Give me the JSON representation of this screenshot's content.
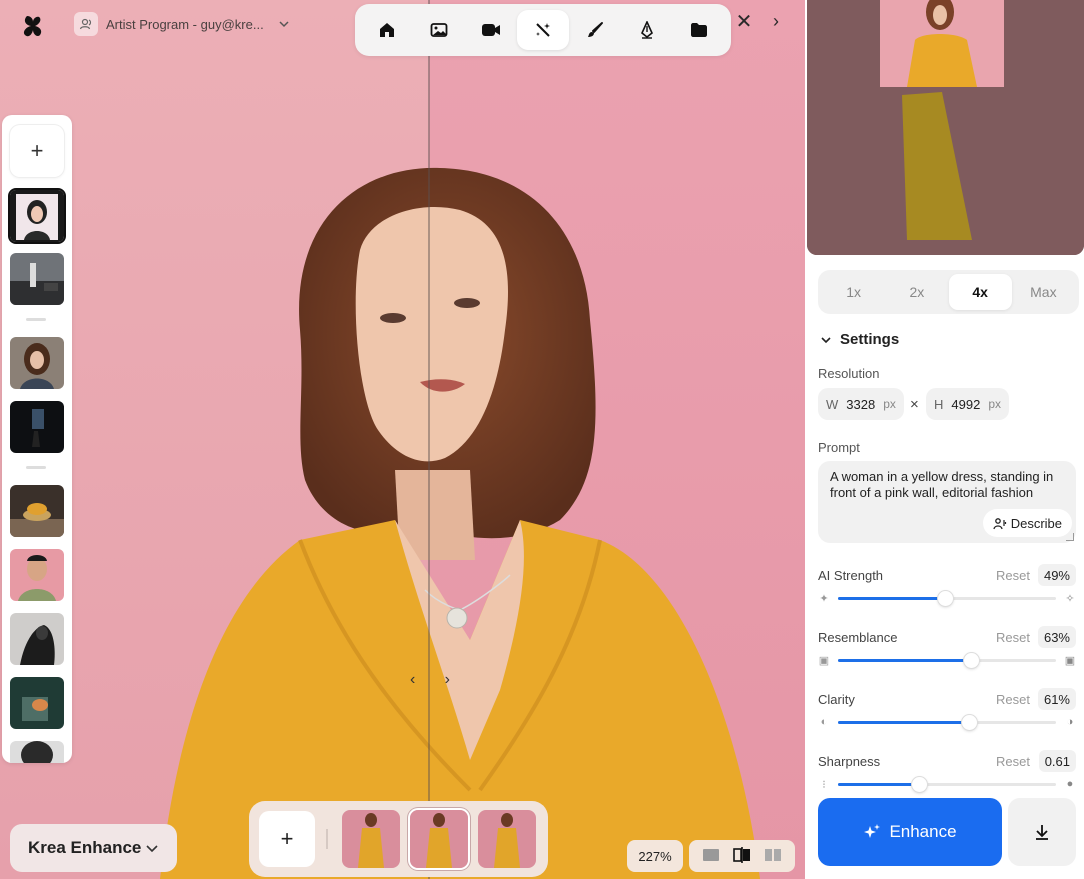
{
  "header": {
    "account_label": "Artist Program - guy@kre...",
    "icons": [
      "krea-logo-icon",
      "user-icon",
      "chevron-down-icon"
    ]
  },
  "toolbar": {
    "tools": [
      {
        "name": "home-icon"
      },
      {
        "name": "image-icon"
      },
      {
        "name": "video-icon"
      },
      {
        "name": "enhance-wand-icon",
        "active": true
      },
      {
        "name": "brush-icon"
      },
      {
        "name": "pen-nib-icon"
      },
      {
        "name": "folder-icon"
      }
    ],
    "close_glyph": "✕",
    "next_glyph": "›"
  },
  "canvas": {
    "compare_prev": "‹",
    "compare_next": "›",
    "zoom": "227%"
  },
  "history": {
    "add_glyph": "+"
  },
  "model": {
    "label": "Krea Enhance"
  },
  "strip": {
    "add_glyph": "+"
  },
  "panel": {
    "scale_options": [
      "1x",
      "2x",
      "4x",
      "Max"
    ],
    "scale_selected": "4x",
    "settings_title": "Settings",
    "resolution_label": "Resolution",
    "width": {
      "key": "W",
      "value": "3328",
      "unit": "px"
    },
    "height": {
      "key": "H",
      "value": "4992",
      "unit": "px"
    },
    "times": "×",
    "prompt_label": "Prompt",
    "prompt_text": "A woman in a yellow dress, standing in front of a pink wall, editorial fashion",
    "describe_label": "Describe",
    "reset_label": "Reset",
    "sliders": [
      {
        "name": "AI Strength",
        "value": "49%",
        "fraction": 0.49
      },
      {
        "name": "Resemblance",
        "value": "63%",
        "fraction": 0.61
      },
      {
        "name": "Clarity",
        "value": "61%",
        "fraction": 0.6
      },
      {
        "name": "Sharpness",
        "value": "0.61",
        "fraction": 0.37
      }
    ],
    "enhance_label": "Enhance"
  },
  "colors": {
    "accent": "#1a6cf0",
    "wall_pink": "#e8a5b0",
    "dress_yellow": "#e9a92a"
  }
}
